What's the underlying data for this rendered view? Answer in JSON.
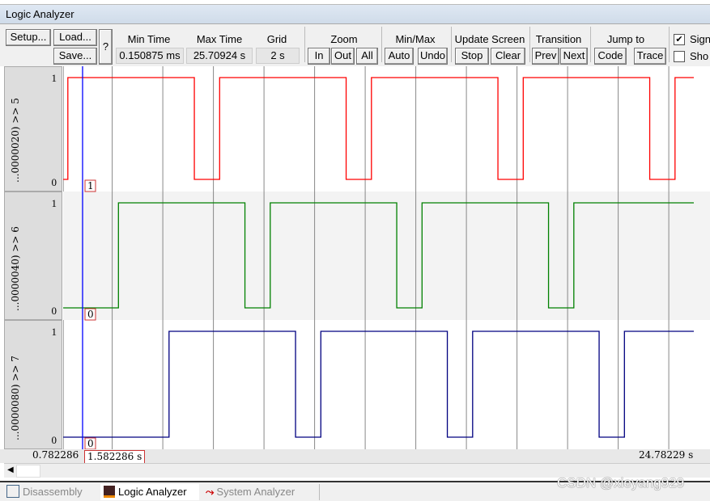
{
  "window": {
    "title": "Logic Analyzer"
  },
  "toolbar": {
    "setup": "Setup...",
    "load": "Load...",
    "save": "Save...",
    "help": "?",
    "min_time_label": "Min Time",
    "min_time": "0.150875 ms",
    "max_time_label": "Max Time",
    "max_time": "25.70924 s",
    "grid_label": "Grid",
    "grid": "2 s",
    "zoom_label": "Zoom",
    "zoom_in": "In",
    "zoom_out": "Out",
    "zoom_all": "All",
    "minmax_label": "Min/Max",
    "auto": "Auto",
    "undo": "Undo",
    "update_label": "Update Screen",
    "stop": "Stop",
    "clear": "Clear",
    "transition_label": "Transition",
    "prev": "Prev",
    "next": "Next",
    "jump_label": "Jump to",
    "code": "Code",
    "trace": "Trace",
    "signal_info": {
      "label": "Sign",
      "checked": true
    },
    "show_cycles": {
      "label": "Sho",
      "checked": false
    }
  },
  "signals": [
    {
      "name": "...0000020) >> 5",
      "color": "#ff0000",
      "high": "1",
      "low": "0",
      "cursor_value": "1",
      "initial": 0,
      "transitions": [
        1,
        6,
        7,
        12,
        13,
        18,
        19,
        24,
        25
      ]
    },
    {
      "name": "...0000040) >> 6",
      "color": "#008000",
      "high": "1",
      "low": "0",
      "cursor_value": "0",
      "initial": 0,
      "transitions": [
        3,
        8,
        9,
        14,
        15,
        20,
        21
      ]
    },
    {
      "name": "...0000080) >> 7",
      "color": "#000080",
      "high": "1",
      "low": "0",
      "cursor_value": "0",
      "initial": 0,
      "transitions": [
        5,
        10,
        11,
        16,
        17,
        22,
        23
      ]
    }
  ],
  "time_axis": {
    "start": "0.782286",
    "end": "24.78229 s",
    "start_value": 0.782286,
    "end_value": 24.78229,
    "grid_s": 2,
    "cursor_time": "1.582286 s",
    "cursor_value": 1.582286,
    "cursor_color": "#0000ff"
  },
  "tabs": [
    {
      "label": "Disassembly",
      "icon": "disassembly-icon"
    },
    {
      "label": "Logic Analyzer",
      "icon": "logic-analyzer-icon",
      "active": true
    },
    {
      "label": "System Analyzer",
      "icon": "system-analyzer-icon"
    }
  ],
  "watermark": "CSDN @xieyang929"
}
